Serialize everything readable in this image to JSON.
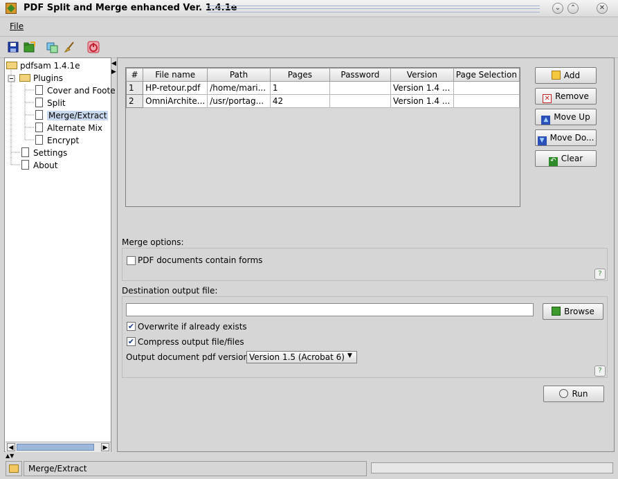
{
  "window": {
    "title": "PDF Split and Merge enhanced Ver. 1.4.1e",
    "minimize_icon": "chevron-down-icon",
    "close_icon": "chevron-up-icon"
  },
  "menu": {
    "file_label": "File"
  },
  "toolbar": {
    "icons": [
      "save-icon",
      "load-icon",
      "settings-icon",
      "clear-icon",
      "exit-icon"
    ]
  },
  "tree": {
    "root": "pdfsam 1.4.1e",
    "plugins": "Plugins",
    "items": [
      "Cover and Foote",
      "Split",
      "Merge/Extract",
      "Alternate Mix",
      "Encrypt"
    ],
    "settings": "Settings",
    "about": "About",
    "selected": "Merge/Extract"
  },
  "table": {
    "headers": [
      "#",
      "File name",
      "Path",
      "Pages",
      "Password",
      "Version",
      "Page Selection"
    ],
    "rows": [
      [
        "1",
        "HP-retour.pdf",
        "/home/mari...",
        "1",
        "",
        "Version 1.4 ...",
        ""
      ],
      [
        "2",
        "OmniArchite...",
        "/usr/portag...",
        "42",
        "",
        "Version 1.4 ...",
        ""
      ]
    ]
  },
  "buttons": {
    "add": "Add",
    "remove": "Remove",
    "move_up": "Move Up",
    "move_down": "Move Do...",
    "clear": "Clear",
    "browse": "Browse",
    "run": "Run"
  },
  "merge_options": {
    "label": "Merge options:",
    "forms_checkbox": "PDF documents contain forms",
    "forms_checked": false
  },
  "destination": {
    "label": "Destination output file:",
    "value": "",
    "overwrite_label": "Overwrite if already exists",
    "overwrite_checked": true,
    "compress_label": "Compress output file/files",
    "compress_checked": true,
    "version_label": "Output document pdf version:",
    "version_value": "Version 1.5 (Acrobat 6)"
  },
  "status": {
    "text": "Merge/Extract"
  }
}
